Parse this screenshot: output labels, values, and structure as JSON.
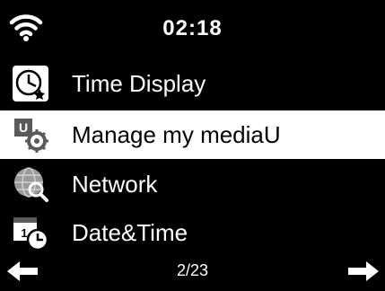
{
  "status": {
    "time": "02:18",
    "wifi_icon": "wifi-icon"
  },
  "menu": {
    "items": [
      {
        "label": "Time Display",
        "icon": "clock-icon",
        "selected": false
      },
      {
        "label": "Manage my mediaU",
        "icon": "mediau-settings-icon",
        "selected": true
      },
      {
        "label": "Network",
        "icon": "network-globe-icon",
        "selected": false
      },
      {
        "label": "Date&Time",
        "icon": "calendar-clock-icon",
        "selected": false
      }
    ]
  },
  "footer": {
    "page": "2/23",
    "left_icon": "arrow-left-icon",
    "right_icon": "arrow-right-icon"
  },
  "colors": {
    "background": "#000000",
    "text": "#ffffff",
    "highlight": "#ffffff",
    "highlight_text": "#000000"
  }
}
